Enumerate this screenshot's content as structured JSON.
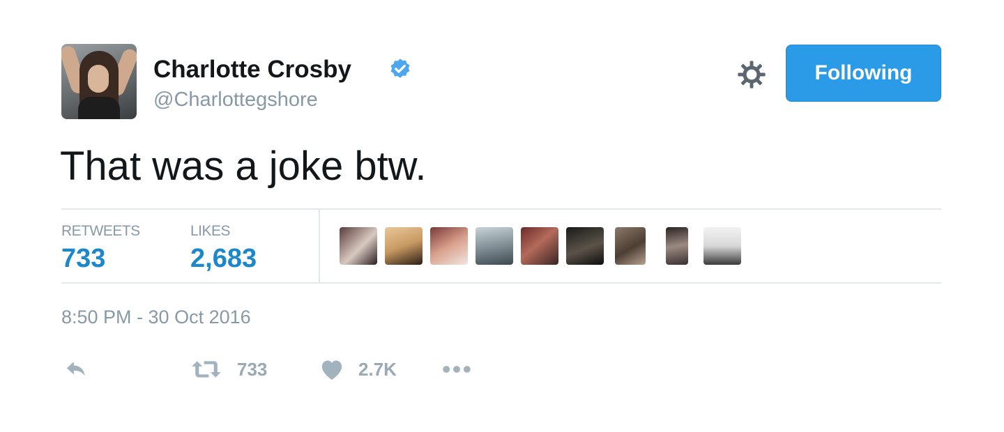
{
  "author": {
    "name": "Charlotte Crosby",
    "handle": "@Charlottegshore",
    "verified": true
  },
  "follow_button": {
    "label": "Following"
  },
  "tweet": {
    "text": "That was a joke btw."
  },
  "stats": {
    "retweets_label": "RETWEETS",
    "retweets_value": "733",
    "likes_label": "LIKES",
    "likes_value": "2,683"
  },
  "likers": [
    {
      "icon": "liker-avatar-1"
    },
    {
      "icon": "liker-avatar-2"
    },
    {
      "icon": "liker-avatar-3"
    },
    {
      "icon": "liker-avatar-4"
    },
    {
      "icon": "liker-avatar-5"
    },
    {
      "icon": "liker-avatar-6"
    },
    {
      "icon": "liker-avatar-7"
    },
    {
      "icon": "liker-avatar-8"
    },
    {
      "icon": "liker-avatar-9"
    }
  ],
  "timestamp": "8:50 PM - 30 Oct 2016",
  "actions": {
    "reply_icon": "reply-icon",
    "retweet_icon": "retweet-icon",
    "retweet_count": "733",
    "like_icon": "heart-icon",
    "like_count": "2.7K",
    "more_icon": "more-icon"
  },
  "colors": {
    "accent": "#2b9be7",
    "stat_value": "#1b88cc",
    "muted": "#8899a6",
    "verified": "#4da7f0",
    "text": "#14171a",
    "divider": "#e1e8ed"
  }
}
